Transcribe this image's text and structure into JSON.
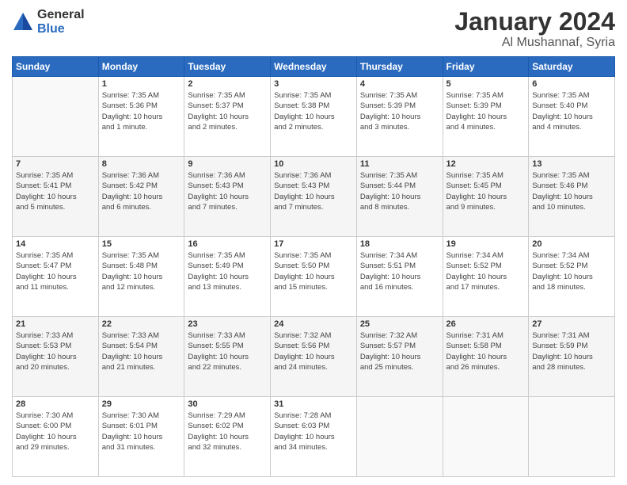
{
  "logo": {
    "general": "General",
    "blue": "Blue"
  },
  "title": "January 2024",
  "subtitle": "Al Mushannaf, Syria",
  "days_header": [
    "Sunday",
    "Monday",
    "Tuesday",
    "Wednesday",
    "Thursday",
    "Friday",
    "Saturday"
  ],
  "weeks": [
    [
      {
        "day": "",
        "info": ""
      },
      {
        "day": "1",
        "info": "Sunrise: 7:35 AM\nSunset: 5:36 PM\nDaylight: 10 hours\nand 1 minute."
      },
      {
        "day": "2",
        "info": "Sunrise: 7:35 AM\nSunset: 5:37 PM\nDaylight: 10 hours\nand 2 minutes."
      },
      {
        "day": "3",
        "info": "Sunrise: 7:35 AM\nSunset: 5:38 PM\nDaylight: 10 hours\nand 2 minutes."
      },
      {
        "day": "4",
        "info": "Sunrise: 7:35 AM\nSunset: 5:39 PM\nDaylight: 10 hours\nand 3 minutes."
      },
      {
        "day": "5",
        "info": "Sunrise: 7:35 AM\nSunset: 5:39 PM\nDaylight: 10 hours\nand 4 minutes."
      },
      {
        "day": "6",
        "info": "Sunrise: 7:35 AM\nSunset: 5:40 PM\nDaylight: 10 hours\nand 4 minutes."
      }
    ],
    [
      {
        "day": "7",
        "info": "Sunrise: 7:35 AM\nSunset: 5:41 PM\nDaylight: 10 hours\nand 5 minutes."
      },
      {
        "day": "8",
        "info": "Sunrise: 7:36 AM\nSunset: 5:42 PM\nDaylight: 10 hours\nand 6 minutes."
      },
      {
        "day": "9",
        "info": "Sunrise: 7:36 AM\nSunset: 5:43 PM\nDaylight: 10 hours\nand 7 minutes."
      },
      {
        "day": "10",
        "info": "Sunrise: 7:36 AM\nSunset: 5:43 PM\nDaylight: 10 hours\nand 7 minutes."
      },
      {
        "day": "11",
        "info": "Sunrise: 7:35 AM\nSunset: 5:44 PM\nDaylight: 10 hours\nand 8 minutes."
      },
      {
        "day": "12",
        "info": "Sunrise: 7:35 AM\nSunset: 5:45 PM\nDaylight: 10 hours\nand 9 minutes."
      },
      {
        "day": "13",
        "info": "Sunrise: 7:35 AM\nSunset: 5:46 PM\nDaylight: 10 hours\nand 10 minutes."
      }
    ],
    [
      {
        "day": "14",
        "info": "Sunrise: 7:35 AM\nSunset: 5:47 PM\nDaylight: 10 hours\nand 11 minutes."
      },
      {
        "day": "15",
        "info": "Sunrise: 7:35 AM\nSunset: 5:48 PM\nDaylight: 10 hours\nand 12 minutes."
      },
      {
        "day": "16",
        "info": "Sunrise: 7:35 AM\nSunset: 5:49 PM\nDaylight: 10 hours\nand 13 minutes."
      },
      {
        "day": "17",
        "info": "Sunrise: 7:35 AM\nSunset: 5:50 PM\nDaylight: 10 hours\nand 15 minutes."
      },
      {
        "day": "18",
        "info": "Sunrise: 7:34 AM\nSunset: 5:51 PM\nDaylight: 10 hours\nand 16 minutes."
      },
      {
        "day": "19",
        "info": "Sunrise: 7:34 AM\nSunset: 5:52 PM\nDaylight: 10 hours\nand 17 minutes."
      },
      {
        "day": "20",
        "info": "Sunrise: 7:34 AM\nSunset: 5:52 PM\nDaylight: 10 hours\nand 18 minutes."
      }
    ],
    [
      {
        "day": "21",
        "info": "Sunrise: 7:33 AM\nSunset: 5:53 PM\nDaylight: 10 hours\nand 20 minutes."
      },
      {
        "day": "22",
        "info": "Sunrise: 7:33 AM\nSunset: 5:54 PM\nDaylight: 10 hours\nand 21 minutes."
      },
      {
        "day": "23",
        "info": "Sunrise: 7:33 AM\nSunset: 5:55 PM\nDaylight: 10 hours\nand 22 minutes."
      },
      {
        "day": "24",
        "info": "Sunrise: 7:32 AM\nSunset: 5:56 PM\nDaylight: 10 hours\nand 24 minutes."
      },
      {
        "day": "25",
        "info": "Sunrise: 7:32 AM\nSunset: 5:57 PM\nDaylight: 10 hours\nand 25 minutes."
      },
      {
        "day": "26",
        "info": "Sunrise: 7:31 AM\nSunset: 5:58 PM\nDaylight: 10 hours\nand 26 minutes."
      },
      {
        "day": "27",
        "info": "Sunrise: 7:31 AM\nSunset: 5:59 PM\nDaylight: 10 hours\nand 28 minutes."
      }
    ],
    [
      {
        "day": "28",
        "info": "Sunrise: 7:30 AM\nSunset: 6:00 PM\nDaylight: 10 hours\nand 29 minutes."
      },
      {
        "day": "29",
        "info": "Sunrise: 7:30 AM\nSunset: 6:01 PM\nDaylight: 10 hours\nand 31 minutes."
      },
      {
        "day": "30",
        "info": "Sunrise: 7:29 AM\nSunset: 6:02 PM\nDaylight: 10 hours\nand 32 minutes."
      },
      {
        "day": "31",
        "info": "Sunrise: 7:28 AM\nSunset: 6:03 PM\nDaylight: 10 hours\nand 34 minutes."
      },
      {
        "day": "",
        "info": ""
      },
      {
        "day": "",
        "info": ""
      },
      {
        "day": "",
        "info": ""
      }
    ]
  ]
}
